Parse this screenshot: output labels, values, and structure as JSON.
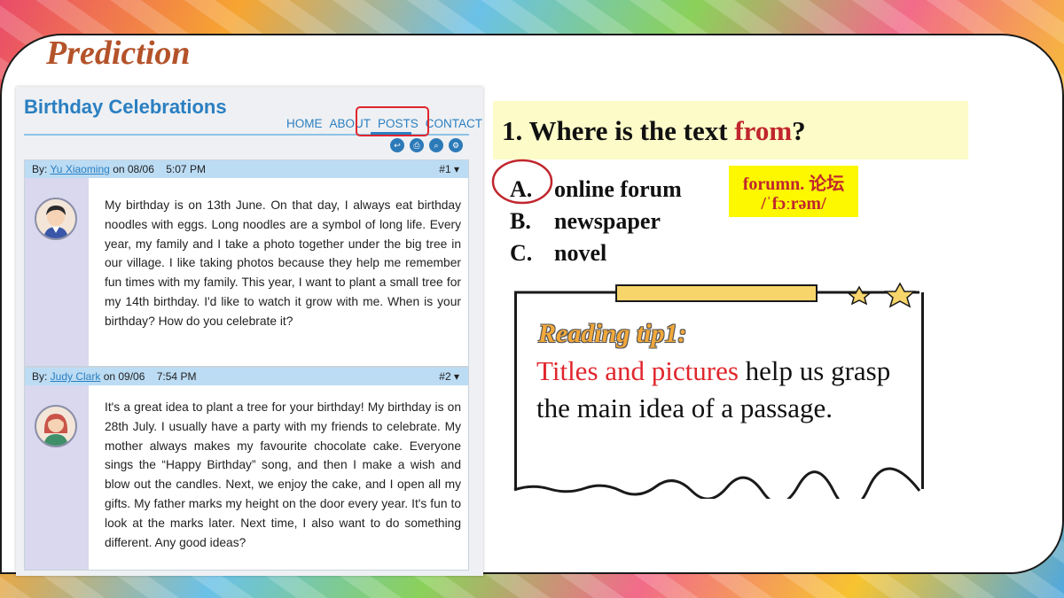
{
  "slide_title": "Prediction",
  "website": {
    "name": "Birthday Celebrations",
    "nav": [
      "HOME",
      "ABOUT",
      "POSTS",
      "CONTACT"
    ],
    "posts": [
      {
        "prefix": "By: ",
        "author": "Yu Xiaoming",
        "date_prefix": " on 08/06",
        "time": "5:07 PM",
        "number": "#1 ▾",
        "text": "My birthday is on 13th June. On that day, I always eat birthday noodles with eggs. Long noodles are a symbol of long life. Every year, my family and I take a photo together under the big tree in our village. I like taking photos because they help me remember fun times with my family. This year, I want to plant a small tree for my 14th birthday. I'd like to watch it grow with me. When is your birthday? How do you celebrate it?"
      },
      {
        "prefix": "By: ",
        "author": "Judy Clark",
        "date_prefix": " on 09/06",
        "time": "7:54 PM",
        "number": "#2 ▾",
        "text": "It's a great idea to plant a tree for your birthday! My birthday is on 28th July. I usually have a party with my friends to celebrate. My mother always makes my favourite chocolate cake. Everyone sings the “Happy Birthday” song, and then I make a wish and blow out the candles. Next, we enjoy the cake, and I open all my gifts. My father marks my height on the door every year. It's fun to look at the marks later. Next time, I also want to do something different. Any good ideas?"
      }
    ]
  },
  "question": {
    "prefix": "1. Where is the text ",
    "highlight": "from",
    "suffix": "?"
  },
  "options": [
    {
      "letter": "A.",
      "text": "online forum"
    },
    {
      "letter": "B.",
      "text": "newspaper"
    },
    {
      "letter": "C.",
      "text": "novel"
    }
  ],
  "vocab": {
    "word": "forumn. 论坛",
    "phonetic": "/ˈfɔːrəm/"
  },
  "tip": {
    "title": "Reading tip1:",
    "highlight": "Titles and pictures",
    "rest": " help us grasp the main idea of a passage."
  },
  "colors": {
    "accent_red": "#e0262d",
    "site_blue": "#2a7fc1",
    "title_brown": "#b4532a"
  }
}
